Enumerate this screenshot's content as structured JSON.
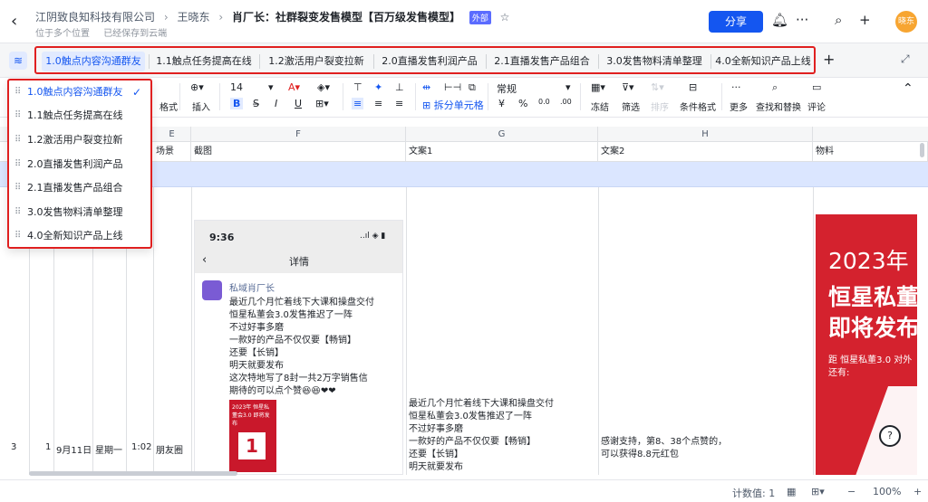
{
  "header": {
    "breadcrumb": [
      "江阴致良知科技有限公司",
      "王晓东"
    ],
    "separator": "›",
    "title": "肖厂长：社群裂变发售模型【百万级发售模型】",
    "external_tag": "外部",
    "location": "位于多个位置",
    "save_status": "已经保存到云端",
    "share_label": "分享",
    "avatar_text": "晓东"
  },
  "tabs": [
    {
      "label": "1.0触点内容沟通群友",
      "active": true
    },
    {
      "label": "1.1触点任务提高在线",
      "active": false
    },
    {
      "label": "1.2激活用户裂变拉新",
      "active": false
    },
    {
      "label": "2.0直播发售利润产品",
      "active": false
    },
    {
      "label": "2.1直播发售产品组合",
      "active": false
    },
    {
      "label": "3.0发售物料清单整理",
      "active": false
    },
    {
      "label": "4.0全新知识产品上线",
      "active": false
    }
  ],
  "toolbar": {
    "format_label": "格式",
    "insert_label": "插入",
    "font_size": "14",
    "number_format": "常规",
    "merge_label": "拆分单元格",
    "freeze_label": "冻结",
    "filter_label": "筛选",
    "sort_label": "排序",
    "cond_label": "条件格式",
    "more_label": "更多",
    "find_label": "查找和替换",
    "comment_label": "评论",
    "currency": "¥",
    "percent": "%",
    "dec1": "0.0",
    "dec2": ".00"
  },
  "columns": [
    "E",
    "F",
    "G",
    "H"
  ],
  "header_row": {
    "e": "场景",
    "f": "截图",
    "g": "文案1",
    "h": "文案2",
    "i": "物料"
  },
  "row": {
    "row_num": "3",
    "num": "1",
    "date": "9月11日",
    "weekday": "星期一",
    "time": "1:02",
    "scene": "朋友圈",
    "copy1": [
      "最近几个月忙着线下大课和操盘交付",
      "恒星私董会3.0发售推迟了一阵",
      "不过好事多磨",
      "一款好的产品不仅仅要【畅销】",
      "还要【长销】",
      "明天就要发布"
    ],
    "copy2": [
      "感谢支持，第8、38个点赞的，",
      "可以获得8.8元红包"
    ]
  },
  "phone": {
    "time": "9:36",
    "status": "..ıl ◈ ▮",
    "title": "详情",
    "name": "私域肖厂长",
    "lines": [
      "最近几个月忙着线下大课和操盘交付",
      "恒星私董会3.0发售推迟了一阵",
      "不过好事多磨",
      "一款好的产品不仅仅要【畅销】",
      "还要【长销】",
      "明天就要发布",
      "这次特地写了8封一共2万字销售信",
      "期待的可以点个赞😆😆❤❤"
    ],
    "poster_text": "2023年 恒星私董会3.0 即将发布",
    "poster_num": "1"
  },
  "poster": {
    "year": "2023年",
    "line1": "恒星私董",
    "line2": "即将发布",
    "line3": "距  恒星私董3.0 对外",
    "line4": "还有:"
  },
  "statusbar": {
    "count": "计数值: 1",
    "zoom": "100%"
  },
  "dropdown": [
    {
      "label": "1.0触点内容沟通群友",
      "selected": true
    },
    {
      "label": "1.1触点任务提高在线",
      "selected": false
    },
    {
      "label": "1.2激活用户裂变拉新",
      "selected": false
    },
    {
      "label": "2.0直播发售利润产品",
      "selected": false
    },
    {
      "label": "2.1直播发售产品组合",
      "selected": false
    },
    {
      "label": "3.0发售物料清单整理",
      "selected": false
    },
    {
      "label": "4.0全新知识产品上线",
      "selected": false
    }
  ],
  "colors": {
    "accent": "#1456f0",
    "highlight": "#e02020",
    "poster": "#d4222e"
  }
}
